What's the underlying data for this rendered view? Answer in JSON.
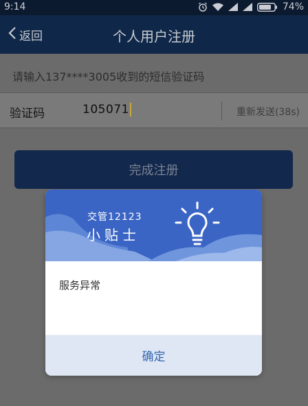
{
  "status_bar": {
    "time": "9:14",
    "battery": "74%",
    "icons": [
      "alarm-icon",
      "wifi-icon",
      "signal-icon",
      "signal-icon",
      "battery-icon"
    ]
  },
  "nav": {
    "back_label": "返回",
    "title": "个人用户注册"
  },
  "form": {
    "hint": "请输入137****3005收到的短信验证码",
    "code_label": "验证码",
    "code_value": "105071",
    "resend_label": "重新发送(38s)",
    "submit_label": "完成注册"
  },
  "dialog": {
    "brand": "交管12123",
    "tip_title": "小贴士",
    "message": "服务异常",
    "confirm_label": "确定",
    "icon": "lightbulb-icon"
  },
  "colors": {
    "status_bar": "#0c1a30",
    "nav_bar": "#0f2748",
    "dialog_header": "#3b65c4",
    "dialog_footer": "#dfe7f4",
    "confirm_text": "#3566b0"
  }
}
